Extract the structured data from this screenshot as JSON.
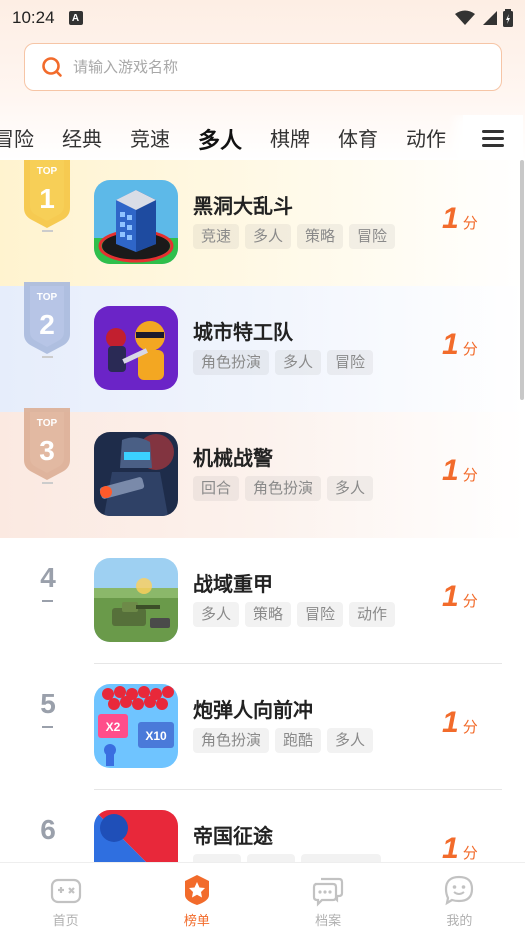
{
  "status_bar": {
    "time": "10:24",
    "notification_letter": "A"
  },
  "search": {
    "placeholder": "请输入游戏名称"
  },
  "tabs": [
    {
      "label": "冒险"
    },
    {
      "label": "经典"
    },
    {
      "label": "竞速"
    },
    {
      "label": "多人",
      "active": true
    },
    {
      "label": "棋牌"
    },
    {
      "label": "体育"
    },
    {
      "label": "动作"
    }
  ],
  "ranking": [
    {
      "rank": "1",
      "badge_text": "TOP",
      "name": "黑洞大乱斗",
      "tags": [
        "竞速",
        "多人",
        "策略",
        "冒险"
      ],
      "score": "1",
      "score_unit": "分"
    },
    {
      "rank": "2",
      "badge_text": "TOP",
      "name": "城市特工队",
      "tags": [
        "角色扮演",
        "多人",
        "冒险"
      ],
      "score": "1",
      "score_unit": "分"
    },
    {
      "rank": "3",
      "badge_text": "TOP",
      "name": "机械战警",
      "tags": [
        "回合",
        "角色扮演",
        "多人"
      ],
      "score": "1",
      "score_unit": "分"
    },
    {
      "rank": "4",
      "name": "战域重甲",
      "tags": [
        "多人",
        "策略",
        "冒险",
        "动作"
      ],
      "score": "1",
      "score_unit": "分"
    },
    {
      "rank": "5",
      "name": "炮弹人向前冲",
      "tags": [
        "角色扮演",
        "跑酷",
        "多人"
      ],
      "score": "1",
      "score_unit": "分"
    },
    {
      "rank": "6",
      "name": "帝国征途",
      "tags": [
        "",
        "",
        ""
      ],
      "score": "1",
      "score_unit": "分"
    }
  ],
  "icon_text": {
    "x2": "X2",
    "x10": "X10"
  },
  "bottom_nav": [
    {
      "label": "首页",
      "icon": "gamepad-icon"
    },
    {
      "label": "榜单",
      "icon": "badge-star-icon",
      "active": true
    },
    {
      "label": "档案",
      "icon": "chat-bubbles-icon"
    },
    {
      "label": "我的",
      "icon": "smile-bubble-icon"
    }
  ],
  "colors": {
    "accent": "#f26b2b",
    "gold": "#f5c542",
    "silver": "#a9b9dd",
    "bronze": "#dcae95"
  }
}
